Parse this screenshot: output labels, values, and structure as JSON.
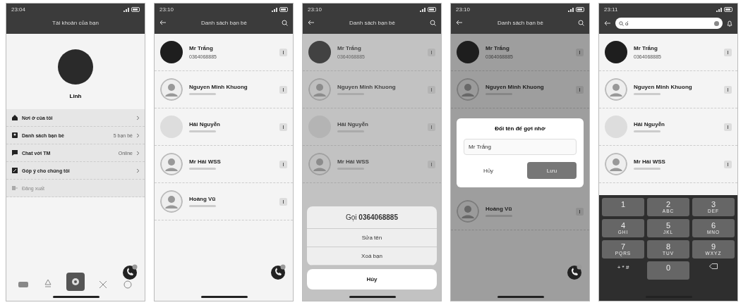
{
  "screens": [
    {
      "kind": "account",
      "status_time": "23:04",
      "title": "Tài khoản của bạn",
      "fab": true,
      "profile": {
        "name": "Linh"
      },
      "menu": [
        {
          "label": "Nơi ở của tôi",
          "disabled": false
        },
        {
          "label": "Danh sách bạn bè",
          "value": "5 bạn bè",
          "disabled": false
        },
        {
          "label": "Chat với TM",
          "value": "Online",
          "disabled": false
        },
        {
          "label": "Góp ý cho chúng tôi",
          "disabled": false
        },
        {
          "label": "Đăng xuất",
          "disabled": true
        }
      ],
      "nav": [
        {
          "selected": false
        },
        {
          "selected": false
        },
        {
          "selected": true
        },
        {
          "selected": false
        },
        {
          "selected": false
        }
      ]
    },
    {
      "kind": "friends",
      "status_time": "23:10",
      "title": "Danh sách bạn bè",
      "fab": true,
      "contacts": [
        {
          "name": "Mr Trắng",
          "phone": "0364068885",
          "kind": "photo"
        },
        {
          "name": "Nguyen Minh Khuong",
          "kind": "default"
        },
        {
          "name": "Hải Nguyễn",
          "kind": "pet"
        },
        {
          "name": "Mr Hải WSS",
          "kind": "default"
        },
        {
          "name": "Hoàng Vũ",
          "kind": "default"
        }
      ]
    },
    {
      "kind": "friends",
      "status_time": "23:10",
      "title": "Danh sách bạn bè",
      "fab": false,
      "contacts": [
        {
          "name": "Mr Trắng",
          "phone": "0364068885",
          "kind": "photo"
        },
        {
          "name": "Nguyen Minh Khuong",
          "kind": "default"
        },
        {
          "name": "Hải Nguyễn",
          "kind": "pet"
        },
        {
          "name": "Mr Hải WSS",
          "kind": "default"
        }
      ],
      "overlay": {
        "kind": "action_sheet",
        "title": "Gọi **0364068885**",
        "actions": [
          "Sửa tên",
          "Xoá bạn"
        ],
        "cancel": "Hủy"
      }
    },
    {
      "kind": "friends",
      "status_time": "23:10",
      "title": "Danh sách bạn bè",
      "fab": true,
      "contacts": [
        {
          "name": "Mr Trắng",
          "phone": "0364068885",
          "kind": "photo"
        },
        {
          "name": "Nguyen Minh Khuong",
          "kind": "default"
        }
      ],
      "overlay": {
        "kind": "rename_dialog",
        "title": "Đổi tên để gợi nhớ",
        "value": "Mr Trắng",
        "buttons": [
          "Hủy",
          "Lưu"
        ]
      },
      "contacts_below": [
        {
          "name": "Hoàng Vũ",
          "kind": "default"
        }
      ]
    },
    {
      "kind": "search",
      "status_time": "23:11",
      "fab": false,
      "search": {
        "value": "ố"
      },
      "contacts": [
        {
          "name": "Mr Trắng",
          "phone": "0364068885",
          "kind": "photo"
        },
        {
          "name": "Nguyen Minh Khuong",
          "kind": "default"
        },
        {
          "name": "Hải Nguyễn",
          "kind": "pet"
        },
        {
          "name": "Mr Hải WSS",
          "kind": "default"
        }
      ],
      "keypad": [
        {
          "digit": "1"
        },
        {
          "digit": "2",
          "letters": "ABC"
        },
        {
          "digit": "3",
          "letters": "DEF"
        },
        {
          "digit": "4",
          "letters": "GHI"
        },
        {
          "digit": "5",
          "letters": "JKL"
        },
        {
          "digit": "6",
          "letters": "MNO"
        },
        {
          "digit": "7",
          "letters": "PQRS"
        },
        {
          "digit": "8",
          "letters": "TUV"
        },
        {
          "digit": "9",
          "letters": "WXYZ"
        },
        {
          "kind": "symbols",
          "label": "+ * #"
        },
        {
          "digit": "0"
        },
        {
          "kind": "backspace"
        }
      ]
    }
  ]
}
